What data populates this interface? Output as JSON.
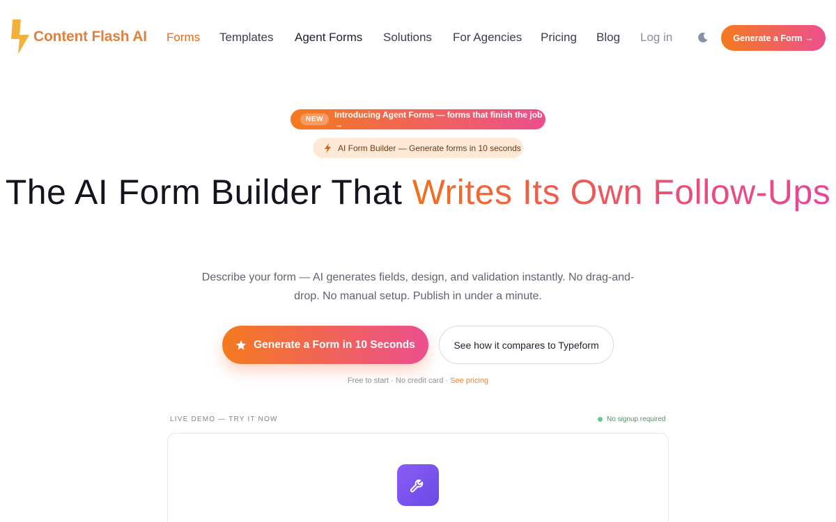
{
  "brand": {
    "name": "Content Flash AI",
    "accent": "#f47a1f",
    "accent_end": "#ec4f8e"
  },
  "nav": {
    "links": [
      {
        "label": "Forms"
      },
      {
        "label": "Templates"
      },
      {
        "label": "Agent Forms"
      },
      {
        "label": "Solutions"
      },
      {
        "label": "For Agencies"
      },
      {
        "label": "Pricing"
      },
      {
        "label": "Blog"
      },
      {
        "label": "Log in"
      }
    ],
    "theme_toggle_icon": "moon-icon",
    "cta_label": "Generate a Form →"
  },
  "announcement": {
    "badge": "NEW",
    "text": "Introducing Agent Forms — forms that finish the job →"
  },
  "builder_pill": {
    "icon": "bolt-icon",
    "text": "AI Form Builder — Generate forms in 10 seconds"
  },
  "hero": {
    "title_plain": "The AI Form Builder That ",
    "title_highlight": "Writes Its Own Follow-Ups",
    "subtitle": "Describe your form — AI generates fields, design, and validation instantly. No drag-and-drop. No manual setup. Publish in under a minute.",
    "primary_cta": "Generate a Form in 10 Seconds",
    "primary_cta_icon": "star-icon",
    "secondary_cta": "See how it compares to Typeform",
    "fine_print": "Free to start · No credit card · ",
    "fine_print_link": "See pricing"
  },
  "demo": {
    "label": "LIVE DEMO — TRY IT NOW",
    "status": "No signup required",
    "icon": "wrench-icon"
  }
}
